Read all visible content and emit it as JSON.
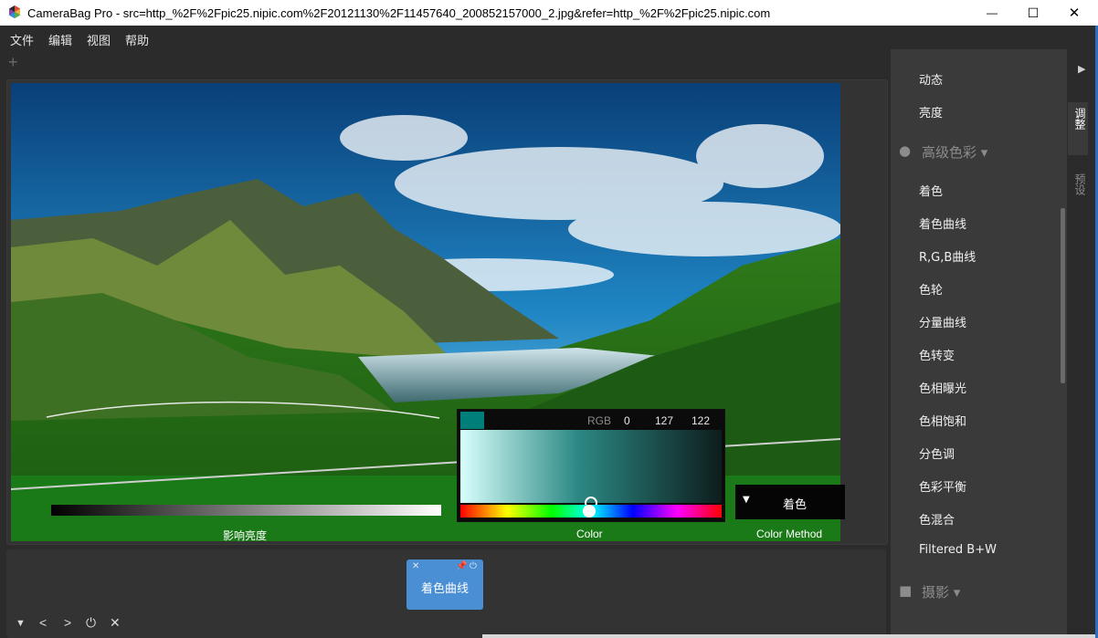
{
  "window": {
    "title": "CameraBag Pro - src=http_%2F%2Fpic25.nipic.com%2F20121130%2F11457640_200852157000_2.jpg&refer=http_%2F%2Fpic25.nipic.com",
    "minimize_glyph": "—",
    "maximize_glyph": "☐",
    "close_glyph": "✕"
  },
  "menu": [
    "文件",
    "编辑",
    "视图",
    "帮助"
  ],
  "tabs": {
    "add_glyph": "+"
  },
  "controls": {
    "luminance_label": "影响亮度",
    "color_picker": {
      "rgb_label": "RGB",
      "r": "0",
      "g": "127",
      "b": "122",
      "swatch_color": "#007f7a",
      "hue_position": 0.5
    },
    "color_label": "Color",
    "method": {
      "value": "着色",
      "label": "Color Method"
    }
  },
  "bottom": {
    "card_label": "着色曲线",
    "card_icons": {
      "close": "✕",
      "pin": "📌",
      "power": "⏻"
    },
    "buttons": {
      "collapse": "▼",
      "prev": "<",
      "next": ">",
      "power": "⏻",
      "close": "✕"
    }
  },
  "right_panel": {
    "items_top": [
      "动态",
      "亮度"
    ],
    "section_advanced": "高级色彩 ▾",
    "items_advanced": [
      "着色",
      "着色曲线",
      "R,G,B曲线",
      "色轮",
      "分量曲线",
      "色转变",
      "色相曝光",
      "色相饱和",
      "分色调",
      "色彩平衡",
      "色混合",
      "Filtered B+W"
    ],
    "section_photo": "摄影 ▾"
  },
  "side_tabs": {
    "arrow": "▶",
    "adjust": "调整",
    "presets": "预设"
  }
}
